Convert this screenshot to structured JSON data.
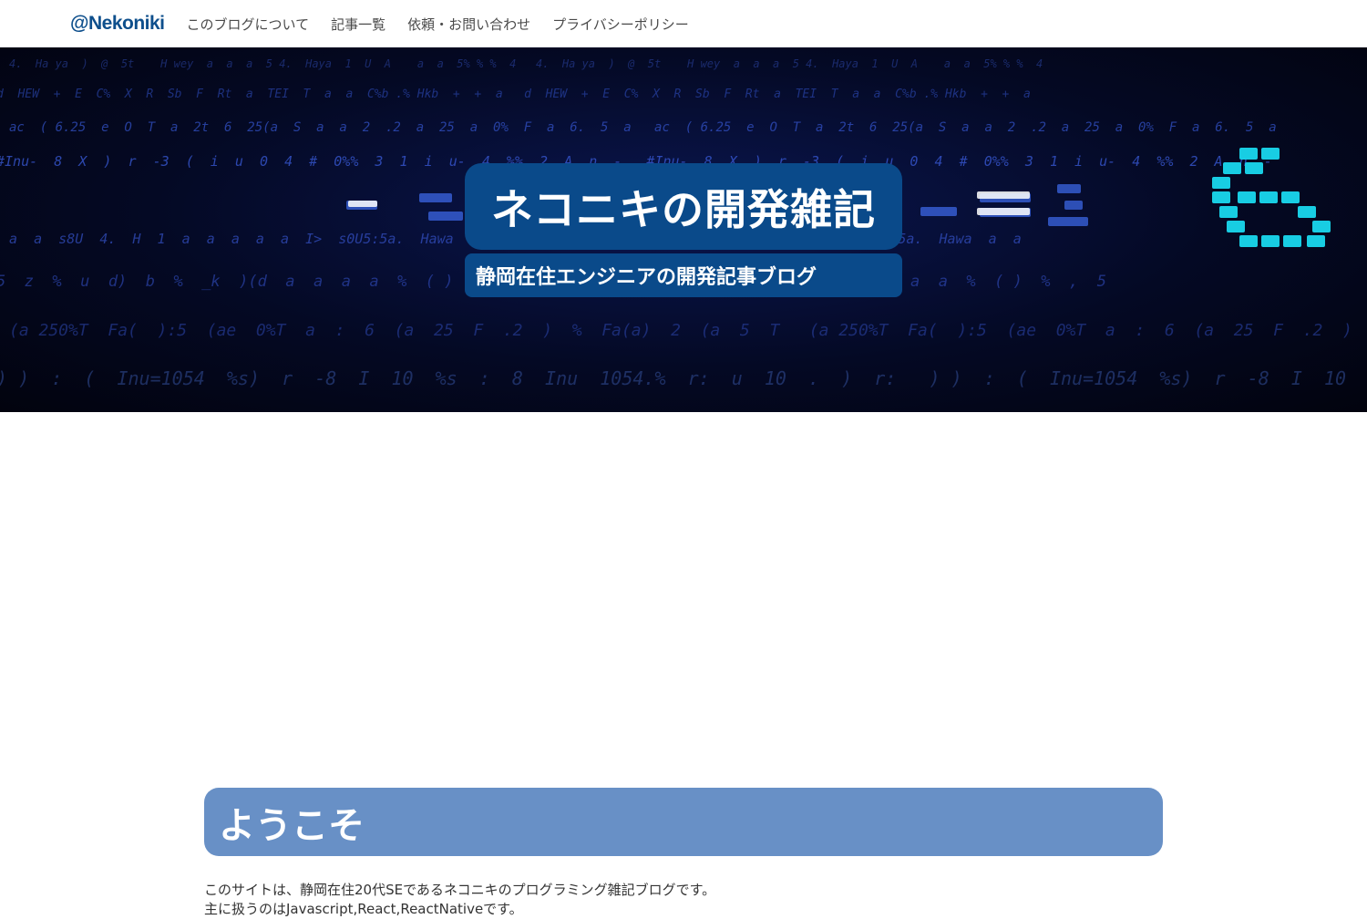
{
  "nav": {
    "brand": "@Nekoniki",
    "links": [
      "このブログについて",
      "記事一覧",
      "依頼・お問い合わせ",
      "プライバシーポリシー"
    ]
  },
  "hero": {
    "title": "ネコニキの開発雑記",
    "subtitle": "静岡在住エンジニアの開発記事ブログ",
    "code_rows": [
      "4.  Ha ya  )  @  5t    H wey  a  a  a  5 4.  Haya  1  U  A    a  a  5% % %  4",
      "d  HEW  +  E  C%  X  R  Sb  F  Rt  a  TEI  T  a  a  C%b .% Hkb  +  +  a",
      "ac  ( 6.25  e  O  T  a  2t  6  25(a  S  a  a  2  .2  a  25  a  0%  F  a  6.  5  a",
      "#Inu-  8  X  )  r  -3  (  i  u  0  4  #  0%%  3  1  i  u-  4  %%  2  A  n  -",
      "a  a  s8U  4.  H  1  a  a  a  a  a  I>  s0U5:5a.  Hawa  a  a",
      "5  z  %  u  d)  b  %  _k  )(d  a  a  a  a  %  ( )  %  ,  5",
      "(a 250%T  Fa(  ):5  (ae  0%T  a  :  6  (a  25  F  .2  )  %  Fa(a)  2  (a  5  T",
      ") )  :  (  Inu=1054  %s)  r  -8  I  10  %s  :  8  Inu  1054.%  r:  u  10  .  )  r:"
    ]
  },
  "main": {
    "welcome_heading": "ようこそ",
    "intro_lines": [
      "このサイトは、静岡在住20代SEであるネコニキのプログラミング雑記ブログです。",
      "主に扱うのはJavascript,React,ReactNativeです。"
    ]
  },
  "colors": {
    "brand": "#0e4f8c",
    "hero_box": "#0a4a8a",
    "welcome_box": "#6890c6"
  }
}
